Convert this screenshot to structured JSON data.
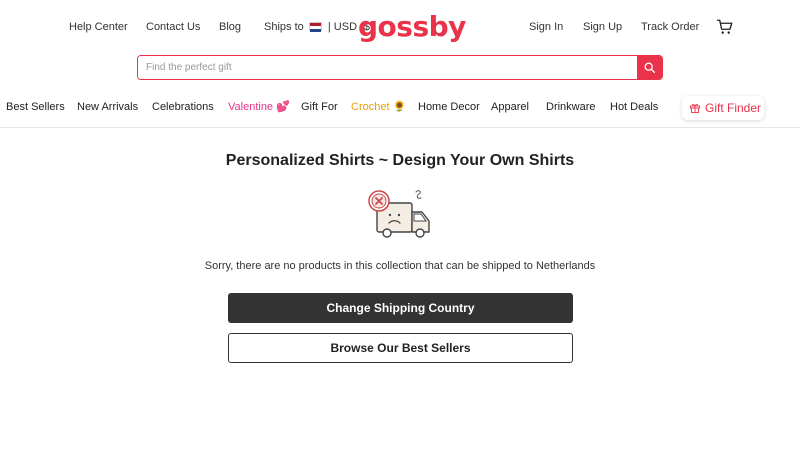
{
  "topbar": {
    "help_center": "Help Center",
    "contact_us": "Contact Us",
    "blog": "Blog",
    "ships_to_label": "Ships to",
    "ships_to_flag": "netherlands-flag",
    "currency": "|  USD ($)",
    "logo": "gossby",
    "sign_in": "Sign In",
    "sign_up": "Sign Up",
    "track_order": "Track Order",
    "cart_icon": "cart-icon"
  },
  "search": {
    "placeholder": "Find the perfect gift",
    "value": "",
    "button_icon": "search-icon"
  },
  "nav": {
    "items": [
      {
        "label": "Best Sellers"
      },
      {
        "label": "New Arrivals"
      },
      {
        "label": "Celebrations"
      },
      {
        "label": "Valentine 💕"
      },
      {
        "label": "Gift For"
      },
      {
        "label": "Crochet 🌻"
      },
      {
        "label": "Home Decor"
      },
      {
        "label": "Apparel"
      },
      {
        "label": "Drinkware"
      },
      {
        "label": "Hot Deals"
      }
    ],
    "gift_finder": "Gift Finder",
    "gift_finder_icon": "gift-icon"
  },
  "main": {
    "title": "Personalized Shirts ~ Design Your Own Shirts",
    "illustration": "sad-delivery-truck-icon",
    "message": "Sorry, there are no products in this collection that can be shipped to Netherlands",
    "primary_button": "Change Shipping Country",
    "secondary_button": "Browse Our Best Sellers"
  },
  "colors": {
    "brand": "#e8334a",
    "valentine": "#e8338a",
    "crochet": "#e8a000",
    "dark_button": "#333333"
  }
}
